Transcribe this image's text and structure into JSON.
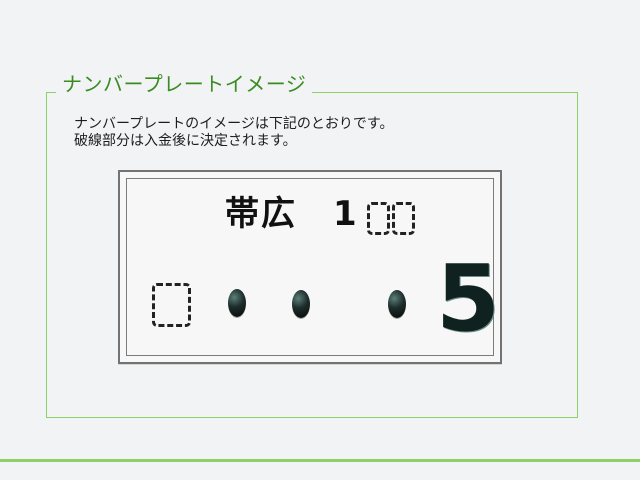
{
  "section": {
    "title": "ナンバープレートイメージ",
    "description_line1": "ナンバープレートのイメージは下記のとおりです。",
    "description_line2": "破線部分は入金後に決定されます。"
  },
  "plate": {
    "region": "帯広",
    "class_digit": "1",
    "serial_digit": "5"
  },
  "icons": {
    "pending_digit": "dashed-box-icon",
    "pending_hiragana": "dashed-box-icon",
    "placeholder_dot": "dot-icon"
  },
  "colors": {
    "accent": "#8fcf6a",
    "legend_text": "#3a8c21",
    "plate_border": "#737373"
  }
}
